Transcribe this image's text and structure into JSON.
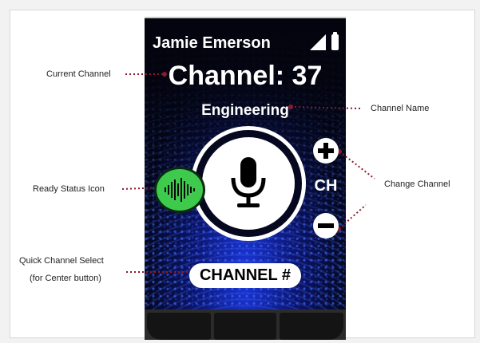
{
  "status": {
    "user_name": "Jamie Emerson",
    "signal_icon": "signal-bars-icon",
    "battery_icon": "battery-icon"
  },
  "channel": {
    "title": "Channel: 37",
    "name": "Engineering"
  },
  "controls": {
    "ptt_icon": "microphone-icon",
    "ready_icon": "audio-waveform-icon",
    "plus_icon": "plus-icon",
    "minus_icon": "minus-icon",
    "ch_label": "CH",
    "channel_select_label": "CHANNEL #"
  },
  "callouts": {
    "current_channel": "Current Channel",
    "channel_name": "Channel Name",
    "ready_status": "Ready Status Icon",
    "change_channel": "Change Channel",
    "quick_select_line1": "Quick Channel Select",
    "quick_select_line2": "(for Center button)"
  },
  "colors": {
    "ready_green": "#3ecb4d",
    "callout_dots": "#8b1a2a",
    "screen_blue": "#1a35d8"
  }
}
